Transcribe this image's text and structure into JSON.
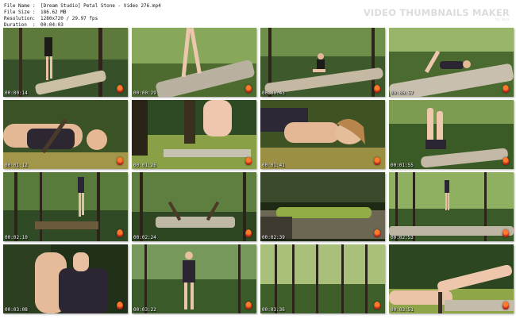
{
  "header": {
    "file_name": {
      "label": "File Name",
      "value": "[Dream Studio] Petal Stone - Video 276.mp4"
    },
    "file_size": {
      "label": "File Size",
      "value": "186.62 MB"
    },
    "resolution": {
      "label": "Resolution",
      "value": "1280x720 / 29.97 fps"
    },
    "duration": {
      "label": "Duration",
      "value": "00:04:03"
    },
    "separator": ":"
  },
  "brand": {
    "title": "VIDEO THUMBNAILS MAKER",
    "subtitle": "by lexx"
  },
  "thumbnails": [
    {
      "time": "00:00:14",
      "scene": "walk-log"
    },
    {
      "time": "00:00:29",
      "scene": "legs-log"
    },
    {
      "time": "00:00:43",
      "scene": "sit-log"
    },
    {
      "time": "00:00:57",
      "scene": "lie-log"
    },
    {
      "time": "00:01:12",
      "scene": "lie-close"
    },
    {
      "time": "00:01:26",
      "scene": "foot-moss"
    },
    {
      "time": "00:01:41",
      "scene": "face-close"
    },
    {
      "time": "00:01:55",
      "scene": "legs-up"
    },
    {
      "time": "00:02:10",
      "scene": "forest-walk"
    },
    {
      "time": "00:02:24",
      "scene": "roots"
    },
    {
      "time": "00:02:39",
      "scene": "moss-log"
    },
    {
      "time": "00:02:53",
      "scene": "forest-far"
    },
    {
      "time": "00:03:08",
      "scene": "torso-close"
    },
    {
      "time": "00:03:22",
      "scene": "stand-forest"
    },
    {
      "time": "00:03:36",
      "scene": "forest-trees"
    },
    {
      "time": "00:03:51",
      "scene": "legs-moss"
    }
  ]
}
